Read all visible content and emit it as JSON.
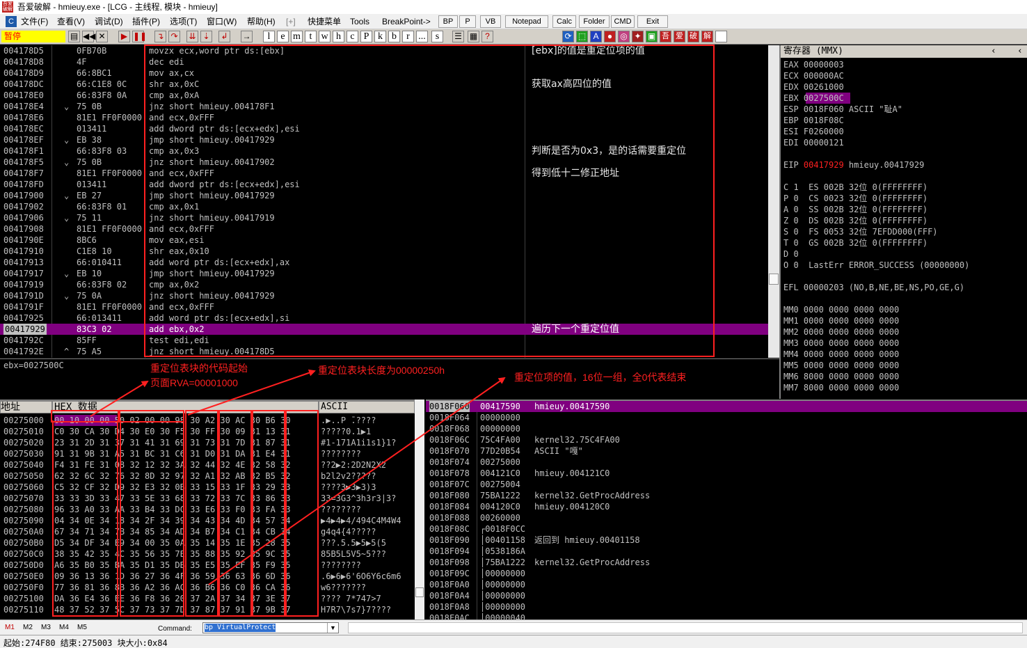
{
  "titlebar": {
    "logo": "吾爱破解",
    "text": "吾爱破解 - hmieuy.exe - [LCG - 主线程, 模块 - hmieuy]"
  },
  "menu": {
    "items": [
      "文件(F)",
      "查看(V)",
      "调试(D)",
      "插件(P)",
      "选项(T)",
      "窗口(W)",
      "帮助(H)",
      "[+]",
      "快捷菜单",
      "Tools",
      "BreakPoint->"
    ],
    "plugin_buttons": [
      "BP",
      "P",
      "VB",
      "Notepad",
      "Calc",
      "Folder",
      "CMD",
      "Exit"
    ]
  },
  "toolbar": {
    "status": "暂停",
    "letters": [
      "l",
      "e",
      "m",
      "t",
      "w",
      "h",
      "c",
      "P",
      "k",
      "b",
      "r",
      "...",
      "s"
    ],
    "tail_icons": [
      "吾",
      "爱",
      "破",
      "解"
    ]
  },
  "disasm": {
    "rows": [
      {
        "addr": "004178D5",
        "mark": "",
        "hex": "0FB70B",
        "code": "movzx ecx,word ptr ds:[ebx]",
        "comment": "[ebx]的值是重定位项的值"
      },
      {
        "addr": "004178D8",
        "mark": "",
        "hex": "4F",
        "code": "dec edi",
        "comment": ""
      },
      {
        "addr": "004178D9",
        "mark": "",
        "hex": "66:8BC1",
        "code": "mov ax,cx",
        "comment": ""
      },
      {
        "addr": "004178DC",
        "mark": "",
        "hex": "66:C1E8 0C",
        "code": "shr ax,0xC",
        "comment": "获取ax高四位的值"
      },
      {
        "addr": "004178E0",
        "mark": "",
        "hex": "66:83F8 0A",
        "code": "cmp ax,0xA",
        "comment": ""
      },
      {
        "addr": "004178E4",
        "mark": "⌄",
        "hex": "75 0B",
        "code": "jnz short hmieuy.004178F1",
        "comment": ""
      },
      {
        "addr": "004178E6",
        "mark": "",
        "hex": "81E1 FF0F0000",
        "code": "and ecx,0xFFF",
        "comment": ""
      },
      {
        "addr": "004178EC",
        "mark": "",
        "hex": "013411",
        "code": "add dword ptr ds:[ecx+edx],esi",
        "comment": ""
      },
      {
        "addr": "004178EF",
        "mark": "⌄",
        "hex": "EB 38",
        "code": "jmp short hmieuy.00417929",
        "comment": ""
      },
      {
        "addr": "004178F1",
        "mark": "",
        "hex": "66:83F8 03",
        "code": "cmp ax,0x3",
        "comment": "判断是否为0x3，是的话需要重定位"
      },
      {
        "addr": "004178F5",
        "mark": "⌄",
        "hex": "75 0B",
        "code": "jnz short hmieuy.00417902",
        "comment": ""
      },
      {
        "addr": "004178F7",
        "mark": "",
        "hex": "81E1 FF0F0000",
        "code": "and ecx,0xFFF",
        "comment": "得到低十二修正地址"
      },
      {
        "addr": "004178FD",
        "mark": "",
        "hex": "013411",
        "code": "add dword ptr ds:[ecx+edx],esi",
        "comment": ""
      },
      {
        "addr": "00417900",
        "mark": "⌄",
        "hex": "EB 27",
        "code": "jmp short hmieuy.00417929",
        "comment": ""
      },
      {
        "addr": "00417902",
        "mark": "",
        "hex": "66:83F8 01",
        "code": "cmp ax,0x1",
        "comment": ""
      },
      {
        "addr": "00417906",
        "mark": "⌄",
        "hex": "75 11",
        "code": "jnz short hmieuy.00417919",
        "comment": ""
      },
      {
        "addr": "00417908",
        "mark": "",
        "hex": "81E1 FF0F0000",
        "code": "and ecx,0xFFF",
        "comment": ""
      },
      {
        "addr": "0041790E",
        "mark": "",
        "hex": "8BC6",
        "code": "mov eax,esi",
        "comment": ""
      },
      {
        "addr": "00417910",
        "mark": "",
        "hex": "C1E8 10",
        "code": "shr eax,0x10",
        "comment": ""
      },
      {
        "addr": "00417913",
        "mark": "",
        "hex": "66:010411",
        "code": "add word ptr ds:[ecx+edx],ax",
        "comment": ""
      },
      {
        "addr": "00417917",
        "mark": "⌄",
        "hex": "EB 10",
        "code": "jmp short hmieuy.00417929",
        "comment": ""
      },
      {
        "addr": "00417919",
        "mark": "",
        "hex": "66:83F8 02",
        "code": "cmp ax,0x2",
        "comment": ""
      },
      {
        "addr": "0041791D",
        "mark": "⌄",
        "hex": "75 0A",
        "code": "jnz short hmieuy.00417929",
        "comment": ""
      },
      {
        "addr": "0041791F",
        "mark": "",
        "hex": "81E1 FF0F0000",
        "code": "and ecx,0xFFF",
        "comment": ""
      },
      {
        "addr": "00417925",
        "mark": "",
        "hex": "66:013411",
        "code": "add word ptr ds:[ecx+edx],si",
        "comment": ""
      },
      {
        "addr": "00417929",
        "mark": "",
        "hex": "83C3 02",
        "code": "add ebx,0x2",
        "comment": "遍历下一个重定位值",
        "selected": true
      },
      {
        "addr": "0041792C",
        "mark": "",
        "hex": "85FF",
        "code": "test edi,edi",
        "comment": ""
      },
      {
        "addr": "0041792E",
        "mark": "^",
        "hex": "75 A5",
        "code": "jnz short hmieuy.004178D5",
        "comment": ""
      }
    ]
  },
  "info": {
    "line": "ebx=0027500C"
  },
  "registers": {
    "title": "寄存器 (MMX)",
    "lines": [
      "EAX 00000003",
      "ECX 000000AC",
      "EDX 00261000",
      "EBX 0027500C",
      "ESP 0018F060 ASCII \"耻A\"",
      "EBP 0018F08C",
      "ESI F0260000",
      "EDI 00000121",
      "",
      "EIP 00417929 hmieuy.00417929",
      "",
      "C 1  ES 002B 32位 0(FFFFFFFF)",
      "P 0  CS 0023 32位 0(FFFFFFFF)",
      "A 0  SS 002B 32位 0(FFFFFFFF)",
      "Z 0  DS 002B 32位 0(FFFFFFFF)",
      "S 0  FS 0053 32位 7EFDD000(FFF)",
      "T 0  GS 002B 32位 0(FFFFFFFF)",
      "D 0",
      "O 0  LastErr ERROR_SUCCESS (00000000)",
      "",
      "EFL 00000203 (NO,B,NE,BE,NS,PO,GE,G)",
      "",
      "MM0 0000 0000 0000 0000",
      "MM1 0000 0000 0000 0000",
      "MM2 0000 0000 0000 0000",
      "MM3 0000 0000 0000 0000",
      "MM4 0000 0000 0000 0000",
      "MM5 0000 0000 0000 0000",
      "MM6 8000 0000 0000 0000",
      "MM7 8000 0000 0000 0000"
    ]
  },
  "dump": {
    "header": {
      "addr": "地址",
      "hex": "HEX 数据",
      "ascii": "ASCII"
    },
    "rows": [
      {
        "a": "00275000",
        "h": "00 10 00 00 50 02 00 00 98 30 A2 30 AC 30 B6 30",
        "s": ".▶..P ̄.????"
      },
      {
        "a": "00275010",
        "h": "C0 30 CA 30 D4 30 E0 30 F5 30 FF 30 09 31 13 31",
        "s": "?????0.1▶1"
      },
      {
        "a": "00275020",
        "h": "23 31 2D 31 37 31 41 31 69 31 73 31 7D 31 87 31",
        "s": "#1-171A1i1s1}1?"
      },
      {
        "a": "00275030",
        "h": "91 31 9B 31 A5 31 BC 31 C6 31 D0 31 DA 31 E4 31",
        "s": "????????"
      },
      {
        "a": "00275040",
        "h": "F4 31 FE 31 08 32 12 32 3A 32 44 32 4E 32 58 32",
        "s": "??2▶2:2D2N2X2"
      },
      {
        "a": "00275050",
        "h": "62 32 6C 32 76 32 8D 32 97 32 A1 32 AB 32 B5 32",
        "s": "b2l2v2?????"
      },
      {
        "a": "00275060",
        "h": "C5 32 CF 32 D9 32 E3 32 0B 33 15 33 1F 33 29 33",
        "s": "????3▶3▶3)3"
      },
      {
        "a": "00275070",
        "h": "33 33 3D 33 47 33 5E 33 68 33 72 33 7C 33 86 33",
        "s": "33=3G3^3h3r3|3?"
      },
      {
        "a": "00275080",
        "h": "96 33 A0 33 AA 33 B4 33 DC 33 E6 33 F0 33 FA 33",
        "s": "????????"
      },
      {
        "a": "00275090",
        "h": "04 34 0E 34 18 34 2F 34 39 34 43 34 4D 34 57 34",
        "s": "▶4▶4▶4/494C4M4W4"
      },
      {
        "a": "002750A0",
        "h": "67 34 71 34 7B 34 85 34 AD 34 B7 34 C1 34 CB 34",
        "s": "g4q4{4?????"
      },
      {
        "a": "002750B0",
        "h": "D5 34 DF 34 E9 34 00 35 0A 35 14 35 1E 35 28 35",
        "s": "???.5.5▶5▶5(5"
      },
      {
        "a": "002750C0",
        "h": "38 35 42 35 4C 35 56 35 7E 35 88 35 92 35 9C 35",
        "s": "85B5L5V5~5???"
      },
      {
        "a": "002750D0",
        "h": "A6 35 B0 35 BA 35 D1 35 DB 35 E5 35 EF 35 F9 35",
        "s": "????????"
      },
      {
        "a": "002750E0",
        "h": "09 36 13 36 1D 36 27 36 4F 36 59 36 63 36 6D 36",
        "s": ".6▶6▶6'6O6Y6c6m6"
      },
      {
        "a": "002750F0",
        "h": "77 36 81 36 8B 36 A2 36 AC 36 B6 36 C0 36 CA 36",
        "s": "w6???????"
      },
      {
        "a": "00275100",
        "h": "DA 36 E4 36 EE 36 F8 36 20 37 2A 37 34 37 3E 37",
        "s": "???? 7*747>7"
      },
      {
        "a": "00275110",
        "h": "48 37 52 37 5C 37 73 37 7D 37 87 37 91 37 9B 37",
        "s": "H7R7\\7s7}7????"
      }
    ]
  },
  "stack": {
    "rows": [
      {
        "a": "0018F060",
        "v": "00417590",
        "c": "hmieuy.00417590",
        "sel": true
      },
      {
        "a": "0018F064",
        "v": "00000000",
        "c": ""
      },
      {
        "a": "0018F068",
        "v": "00000000",
        "c": ""
      },
      {
        "a": "0018F06C",
        "v": "75C4FA00",
        "c": "kernel32.75C4FA00"
      },
      {
        "a": "0018F070",
        "v": "77D20B54",
        "c": "ASCII \"嘎\""
      },
      {
        "a": "0018F074",
        "v": "00275000",
        "c": ""
      },
      {
        "a": "0018F078",
        "v": "004121C0",
        "c": "hmieuy.004121C0"
      },
      {
        "a": "0018F07C",
        "v": "00275004",
        "c": ""
      },
      {
        "a": "0018F080",
        "v": "75BA1222",
        "c": "kernel32.GetProcAddress"
      },
      {
        "a": "0018F084",
        "v": "004120C0",
        "c": "hmieuy.004120C0"
      },
      {
        "a": "0018F088",
        "v": "00260000",
        "c": ""
      },
      {
        "a": "0018F08C",
        "v": "┌0018F0CC",
        "c": ""
      },
      {
        "a": "0018F090",
        "v": "│00401158",
        "c": "返回到 hmieuy.00401158"
      },
      {
        "a": "0018F094",
        "v": "│0538186A",
        "c": ""
      },
      {
        "a": "0018F098",
        "v": "│75BA1222",
        "c": "kernel32.GetProcAddress"
      },
      {
        "a": "0018F09C",
        "v": "│00000000",
        "c": ""
      },
      {
        "a": "0018F0A0",
        "v": "│00000000",
        "c": ""
      },
      {
        "a": "0018F0A4",
        "v": "│00000000",
        "c": ""
      },
      {
        "a": "0018F0A8",
        "v": "│00000000",
        "c": ""
      },
      {
        "a": "0018F0AC",
        "v": "│00000040",
        "c": ""
      }
    ]
  },
  "annotations": {
    "a1": "重定位表块的代码起始",
    "a1b": "页面RVA=00001000",
    "a2": "重定位表块长度为00000250h",
    "a3": "重定位项的值，16位一组，全0代表结束"
  },
  "cmdbar": {
    "tabs": [
      "M1",
      "M2",
      "M3",
      "M4",
      "M5"
    ],
    "label": "Command:",
    "value": "bp VirtualProtect"
  },
  "status": {
    "text": "起始:274F80 结束:275003 块大小:0x84"
  }
}
